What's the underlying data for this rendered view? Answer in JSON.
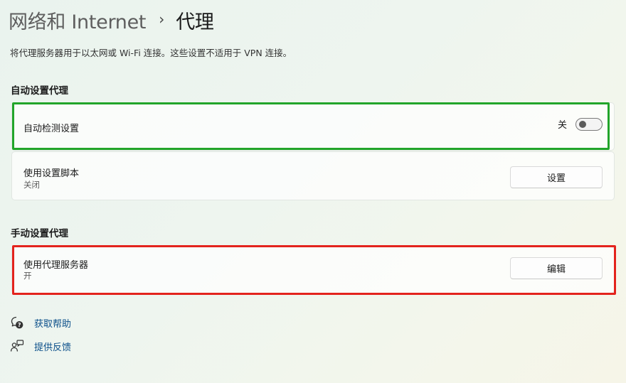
{
  "breadcrumb": {
    "parent": "网络和 Internet",
    "separator": "›",
    "current": "代理"
  },
  "description": "将代理服务器用于以太网或 Wi-Fi 连接。这些设置不适用于 VPN 连接。",
  "auto_section": {
    "title": "自动设置代理",
    "detect_settings": {
      "label": "自动检测设置",
      "toggle_state_label": "关",
      "toggle_on": false
    },
    "setup_script": {
      "label": "使用设置脚本",
      "status": "关闭",
      "button_label": "设置"
    }
  },
  "manual_section": {
    "title": "手动设置代理",
    "proxy_server": {
      "label": "使用代理服务器",
      "status": "开",
      "button_label": "编辑"
    }
  },
  "help": {
    "get_help_label": "获取帮助",
    "feedback_label": "提供反馈"
  },
  "colors": {
    "highlight_green": "#22a52a",
    "highlight_red": "#e3231d",
    "link": "#0b4f8a"
  },
  "icons": {
    "get_help": "help-chat-icon",
    "feedback": "feedback-icon"
  }
}
